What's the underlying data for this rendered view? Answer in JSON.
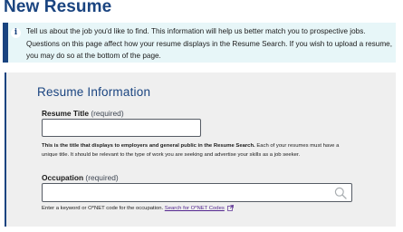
{
  "page": {
    "title": "New Resume"
  },
  "alert": {
    "icon": "info-icon",
    "text": "Tell us about the job you'd like to find. This information will help us better match you to prospective jobs. Questions on this page affect how your resume displays in the Resume Search. If you wish to upload a resume, you may do so at the bottom of the page."
  },
  "section": {
    "title": "Resume Information"
  },
  "resume_title": {
    "label": "Resume Title",
    "required_text": "(required)",
    "value": "",
    "help_bold": "This is the title that displays to employers and general public in the Resume Search.",
    "help_rest": " Each of your resumes must have a unique title. It should be relevant to the type of work you are seeking and advertise your skills as a job seeker."
  },
  "occupation": {
    "label": "Occupation",
    "required_text": "(required)",
    "value": "",
    "help_text": "Enter a keyword or O*NET code for the occupation. ",
    "link_text": "Search for O*NET Codes",
    "icons": {
      "search": "search-icon",
      "external": "external-link-icon"
    }
  },
  "colors": {
    "brand": "#1a4480",
    "alert_bg": "#e7f6f8",
    "card_bg": "#efefef",
    "link": "#54278f"
  }
}
